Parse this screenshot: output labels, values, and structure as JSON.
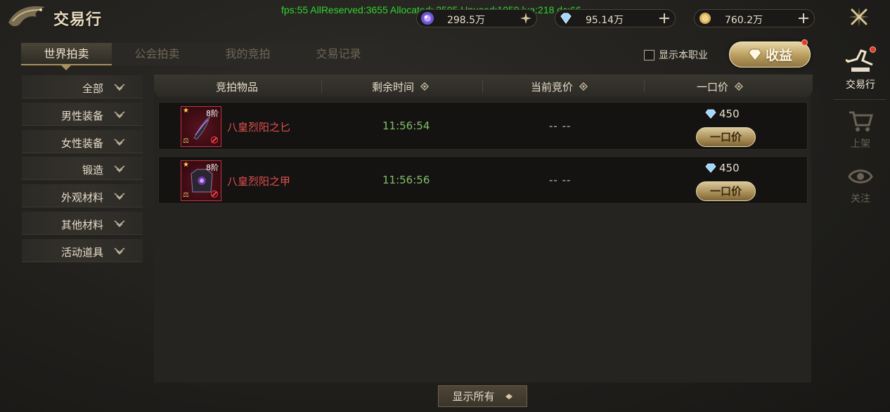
{
  "header": {
    "title": "交易行",
    "debug_overlay": "fps:55 AllReserved:3655 Allocated: 2595 Unused:1059 lua:218 dc:66",
    "currencies": [
      {
        "icon": "gem-orb-icon",
        "value": "298.5万"
      },
      {
        "icon": "diamond-icon",
        "value": "95.14万"
      },
      {
        "icon": "gold-coin-icon",
        "value": "760.2万"
      }
    ]
  },
  "tabs": [
    {
      "label": "世界拍卖",
      "active": true
    },
    {
      "label": "公会拍卖",
      "active": false
    },
    {
      "label": "我的竞拍",
      "active": false
    },
    {
      "label": "交易记录",
      "active": false
    }
  ],
  "filter": {
    "checkbox_label": "显示本职业",
    "checked": false
  },
  "income_button": "收益",
  "categories": [
    "全部",
    "男性装备",
    "女性装备",
    "锻造",
    "外观材料",
    "其他材料",
    "活动道具"
  ],
  "table": {
    "headers": [
      "竞拍物品",
      "剩余时间",
      "当前竞价",
      "一口价"
    ],
    "rows": [
      {
        "item_name": "八皇烈阳之匕",
        "level": "8阶",
        "time_left": "11:56:54",
        "current_bid": "-- --",
        "buyout_price": "450",
        "buy_label": "一口价"
      },
      {
        "item_name": "八皇烈阳之甲",
        "level": "8阶",
        "time_left": "11:56:56",
        "current_bid": "-- --",
        "buyout_price": "450",
        "buy_label": "一口价"
      }
    ]
  },
  "show_all_button": "显示所有",
  "right_nav": [
    {
      "label": "交易行",
      "icon": "auction-hammer-icon",
      "active": true
    },
    {
      "label": "上架",
      "icon": "shopping-cart-icon",
      "active": false
    },
    {
      "label": "关注",
      "icon": "eye-icon",
      "active": false
    }
  ],
  "colors": {
    "accent_gold": "#b89d5e",
    "item_name_red": "#e24f4f",
    "timer_green": "#7fbf6a",
    "debug_green": "#2fd42f"
  }
}
